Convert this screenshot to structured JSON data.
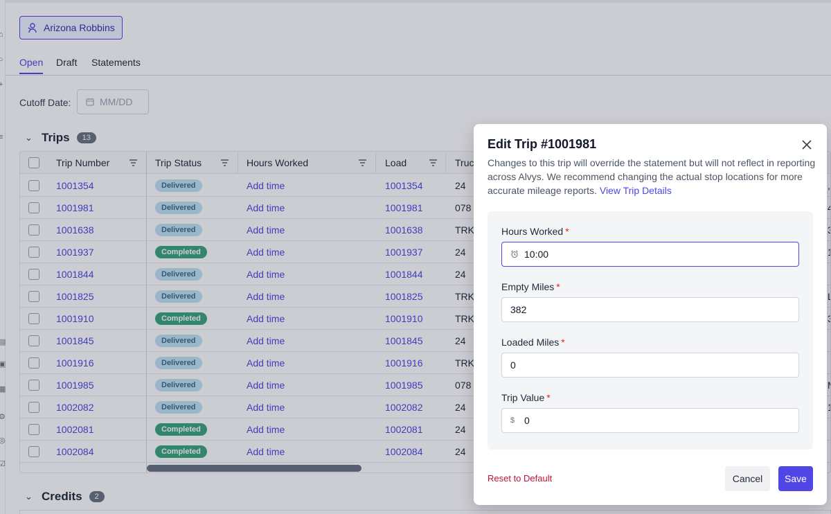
{
  "driver": {
    "name": "Arizona Robbins"
  },
  "tabs": [
    "Open",
    "Draft",
    "Statements"
  ],
  "cutoff": {
    "label": "Cutoff Date:",
    "placeholder": "MM/DD"
  },
  "trips": {
    "title": "Trips",
    "count": "13",
    "columns": [
      "Trip Number",
      "Trip Status",
      "Hours Worked",
      "Load",
      "Truc"
    ],
    "rows": [
      {
        "trip": "1001354",
        "status": "Delivered",
        "hours": "Add time",
        "load": "1001354",
        "truck": "24",
        "edge": ","
      },
      {
        "trip": "1001981",
        "status": "Delivered",
        "hours": "Add time",
        "load": "1001981",
        "truck": "078",
        "edge": "4"
      },
      {
        "trip": "1001638",
        "status": "Delivered",
        "hours": "Add time",
        "load": "1001638",
        "truck": "TRK",
        "edge": "3"
      },
      {
        "trip": "1001937",
        "status": "Completed",
        "hours": "Add time",
        "load": "1001937",
        "truck": "24",
        "edge": "1"
      },
      {
        "trip": "1001844",
        "status": "Delivered",
        "hours": "Add time",
        "load": "1001844",
        "truck": "24",
        "edge": ""
      },
      {
        "trip": "1001825",
        "status": "Delivered",
        "hours": "Add time",
        "load": "1001825",
        "truck": "TRK",
        "edge": "L"
      },
      {
        "trip": "1001910",
        "status": "Completed",
        "hours": "Add time",
        "load": "1001910",
        "truck": "TRK",
        "edge": "3"
      },
      {
        "trip": "1001845",
        "status": "Delivered",
        "hours": "Add time",
        "load": "1001845",
        "truck": "24",
        "edge": ""
      },
      {
        "trip": "1001916",
        "status": "Delivered",
        "hours": "Add time",
        "load": "1001916",
        "truck": "TRK",
        "edge": ""
      },
      {
        "trip": "1001985",
        "status": "Delivered",
        "hours": "Add time",
        "load": "1001985",
        "truck": "078",
        "edge": "M"
      },
      {
        "trip": "1002082",
        "status": "Delivered",
        "hours": "Add time",
        "load": "1002082",
        "truck": "24",
        "edge": "1"
      },
      {
        "trip": "1002081",
        "status": "Completed",
        "hours": "Add time",
        "load": "1002081",
        "truck": "24",
        "edge": ""
      },
      {
        "trip": "1002084",
        "status": "Completed",
        "hours": "Add time",
        "load": "1002084",
        "truck": "24",
        "edge": ""
      }
    ]
  },
  "credits": {
    "title": "Credits",
    "count": "2"
  },
  "modal": {
    "title": "Edit Trip #1001981",
    "description": "Changes to this trip will override the statement but will not reflect in reporting across Alvys. We recommend changing the actual stop locations for more accurate mileage reports.",
    "details_link": "View Trip Details",
    "fields": [
      {
        "label": "Hours Worked",
        "value": "10:00"
      },
      {
        "label": "Empty Miles",
        "value": "382"
      },
      {
        "label": "Loaded Miles",
        "value": "0"
      },
      {
        "label": "Trip Value",
        "value": "0",
        "prefix": "$"
      }
    ],
    "reset_label": "Reset to Default",
    "cancel_label": "Cancel",
    "save_label": "Save"
  },
  "colors": {
    "accent": "#4f46e5",
    "delivered": "#bfe3f2",
    "completed": "#3aa57a",
    "danger": "#be123c"
  }
}
